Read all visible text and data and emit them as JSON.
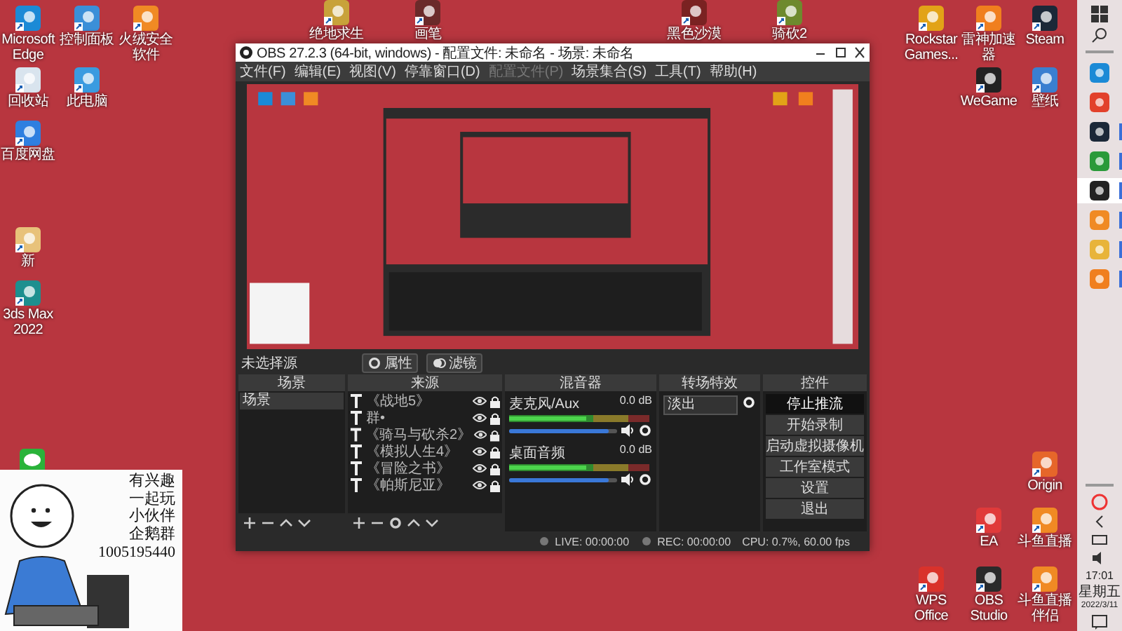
{
  "desktop_icons": [
    {
      "label": "Microsoft Edge"
    },
    {
      "label": "控制面板"
    },
    {
      "label": "火绒安全软件"
    },
    {
      "label": "回收站"
    },
    {
      "label": "此电脑"
    },
    {
      "label": "百度网盘"
    },
    {
      "label": "新"
    },
    {
      "label": "3ds Max 2022"
    },
    {
      "label": "绝地求生"
    },
    {
      "label": "画笔"
    },
    {
      "label": "黑色沙漠"
    },
    {
      "label": "骑砍2"
    },
    {
      "label": "Rockstar Games..."
    },
    {
      "label": "雷神加速器"
    },
    {
      "label": "Steam"
    },
    {
      "label": "WeGame"
    },
    {
      "label": "壁纸"
    },
    {
      "label": "Origin"
    },
    {
      "label": "EA"
    },
    {
      "label": "斗鱼直播"
    },
    {
      "label": "WPS Office"
    },
    {
      "label": "OBS Studio"
    },
    {
      "label": "斗鱼直播伴侣"
    }
  ],
  "overlay": {
    "lines": [
      "有兴趣",
      "一起玩",
      "小伙伴",
      "企鹅群",
      "1005195440"
    ]
  },
  "obs": {
    "title": "OBS 27.2.3 (64-bit, windows) - 配置文件: 未命名 - 场景: 未命名",
    "menu": [
      {
        "label": "文件(F)",
        "disabled": false
      },
      {
        "label": "编辑(E)",
        "disabled": false
      },
      {
        "label": "视图(V)",
        "disabled": false
      },
      {
        "label": "停靠窗口(D)",
        "disabled": false
      },
      {
        "label": "配置文件(P)",
        "disabled": true
      },
      {
        "label": "场景集合(S)",
        "disabled": false
      },
      {
        "label": "工具(T)",
        "disabled": false
      },
      {
        "label": "帮助(H)",
        "disabled": false
      }
    ],
    "source_bar": {
      "label": "未选择源",
      "buttons": [
        "属性",
        "滤镜"
      ]
    },
    "scenes": {
      "title": "场景",
      "items": [
        {
          "label": "场景",
          "selected": true
        }
      ]
    },
    "sources": {
      "title": "来源",
      "items": [
        {
          "label": "《战地5》",
          "visible": true,
          "locked": true
        },
        {
          "label": "群•",
          "visible": true,
          "locked": true
        },
        {
          "label": "《骑马与砍杀2》",
          "visible": true,
          "locked": true
        },
        {
          "label": "《模拟人生4》",
          "visible": true,
          "locked": true
        },
        {
          "label": "《冒险之书》",
          "visible": true,
          "locked": true
        },
        {
          "label": "《帕斯尼亚》",
          "visible": true,
          "locked": true
        }
      ]
    },
    "mixer": {
      "title": "混音器",
      "channels": [
        {
          "name": "麦克风/Aux",
          "reading": "0.0 dB",
          "muted": false,
          "volume": {
            "level": 0.92
          }
        },
        {
          "name": "桌面音频",
          "reading": "0.0 dB",
          "muted": false,
          "volume": {
            "level": 0.92
          }
        }
      ]
    },
    "transitions": {
      "title": "转场特效",
      "value": "淡出"
    },
    "controls": {
      "title": "控件",
      "buttons": [
        {
          "label": "停止推流",
          "active": true
        },
        {
          "label": "开始录制",
          "active": false
        },
        {
          "label": "启动虚拟摄像机",
          "active": false
        },
        {
          "label": "工作室模式",
          "active": false
        },
        {
          "label": "设置",
          "active": false
        },
        {
          "label": "退出",
          "active": false
        }
      ]
    },
    "status": {
      "live": "LIVE: 00:00:00",
      "rec": "REC: 00:00:00",
      "cpu": "CPU: 0.7%, 60.00 fps"
    }
  },
  "taskbar": {
    "apps": [
      {
        "selected": false,
        "running": false
      },
      {
        "selected": false,
        "running": false
      },
      {
        "selected": false,
        "running": true
      },
      {
        "selected": false,
        "running": true
      },
      {
        "selected": true,
        "running": true
      },
      {
        "selected": false,
        "running": true
      },
      {
        "selected": false,
        "running": true
      },
      {
        "selected": false,
        "running": true
      }
    ],
    "tray": {
      "time": "17:01",
      "weekday": "星期五",
      "date": "2022/3/11"
    }
  }
}
